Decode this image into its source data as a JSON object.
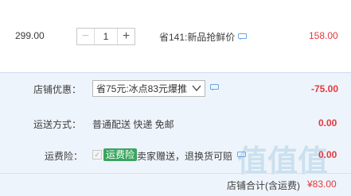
{
  "item": {
    "unit_price": "299.00",
    "quantity": "1",
    "minus_symbol": "−",
    "plus_symbol": "+",
    "promotion": "省141:新品抢鲜价",
    "subtotal": "158.00"
  },
  "shop": {
    "coupon_label": "店铺优惠：",
    "coupon_selected": "省75元:冰点83元爆推",
    "coupon_amount": "-75.00",
    "shipping_label": "运送方式：",
    "shipping_value": "普通配送 快递 免邮",
    "shipping_amount": "0.00",
    "insurance_label": "运费险：",
    "insurance_tag": "运费险",
    "insurance_desc": "卖家赠送，退换货可赔",
    "insurance_amount": "0.00",
    "total_label": "店铺合计(含运费)",
    "total_amount": "¥83.00"
  },
  "watermark": "值值值",
  "colors": {
    "price_red": "#e4393c",
    "panel_bg": "#eef4fb",
    "tag_green": "#3aa55e",
    "note_blue": "#6aa6e0"
  }
}
